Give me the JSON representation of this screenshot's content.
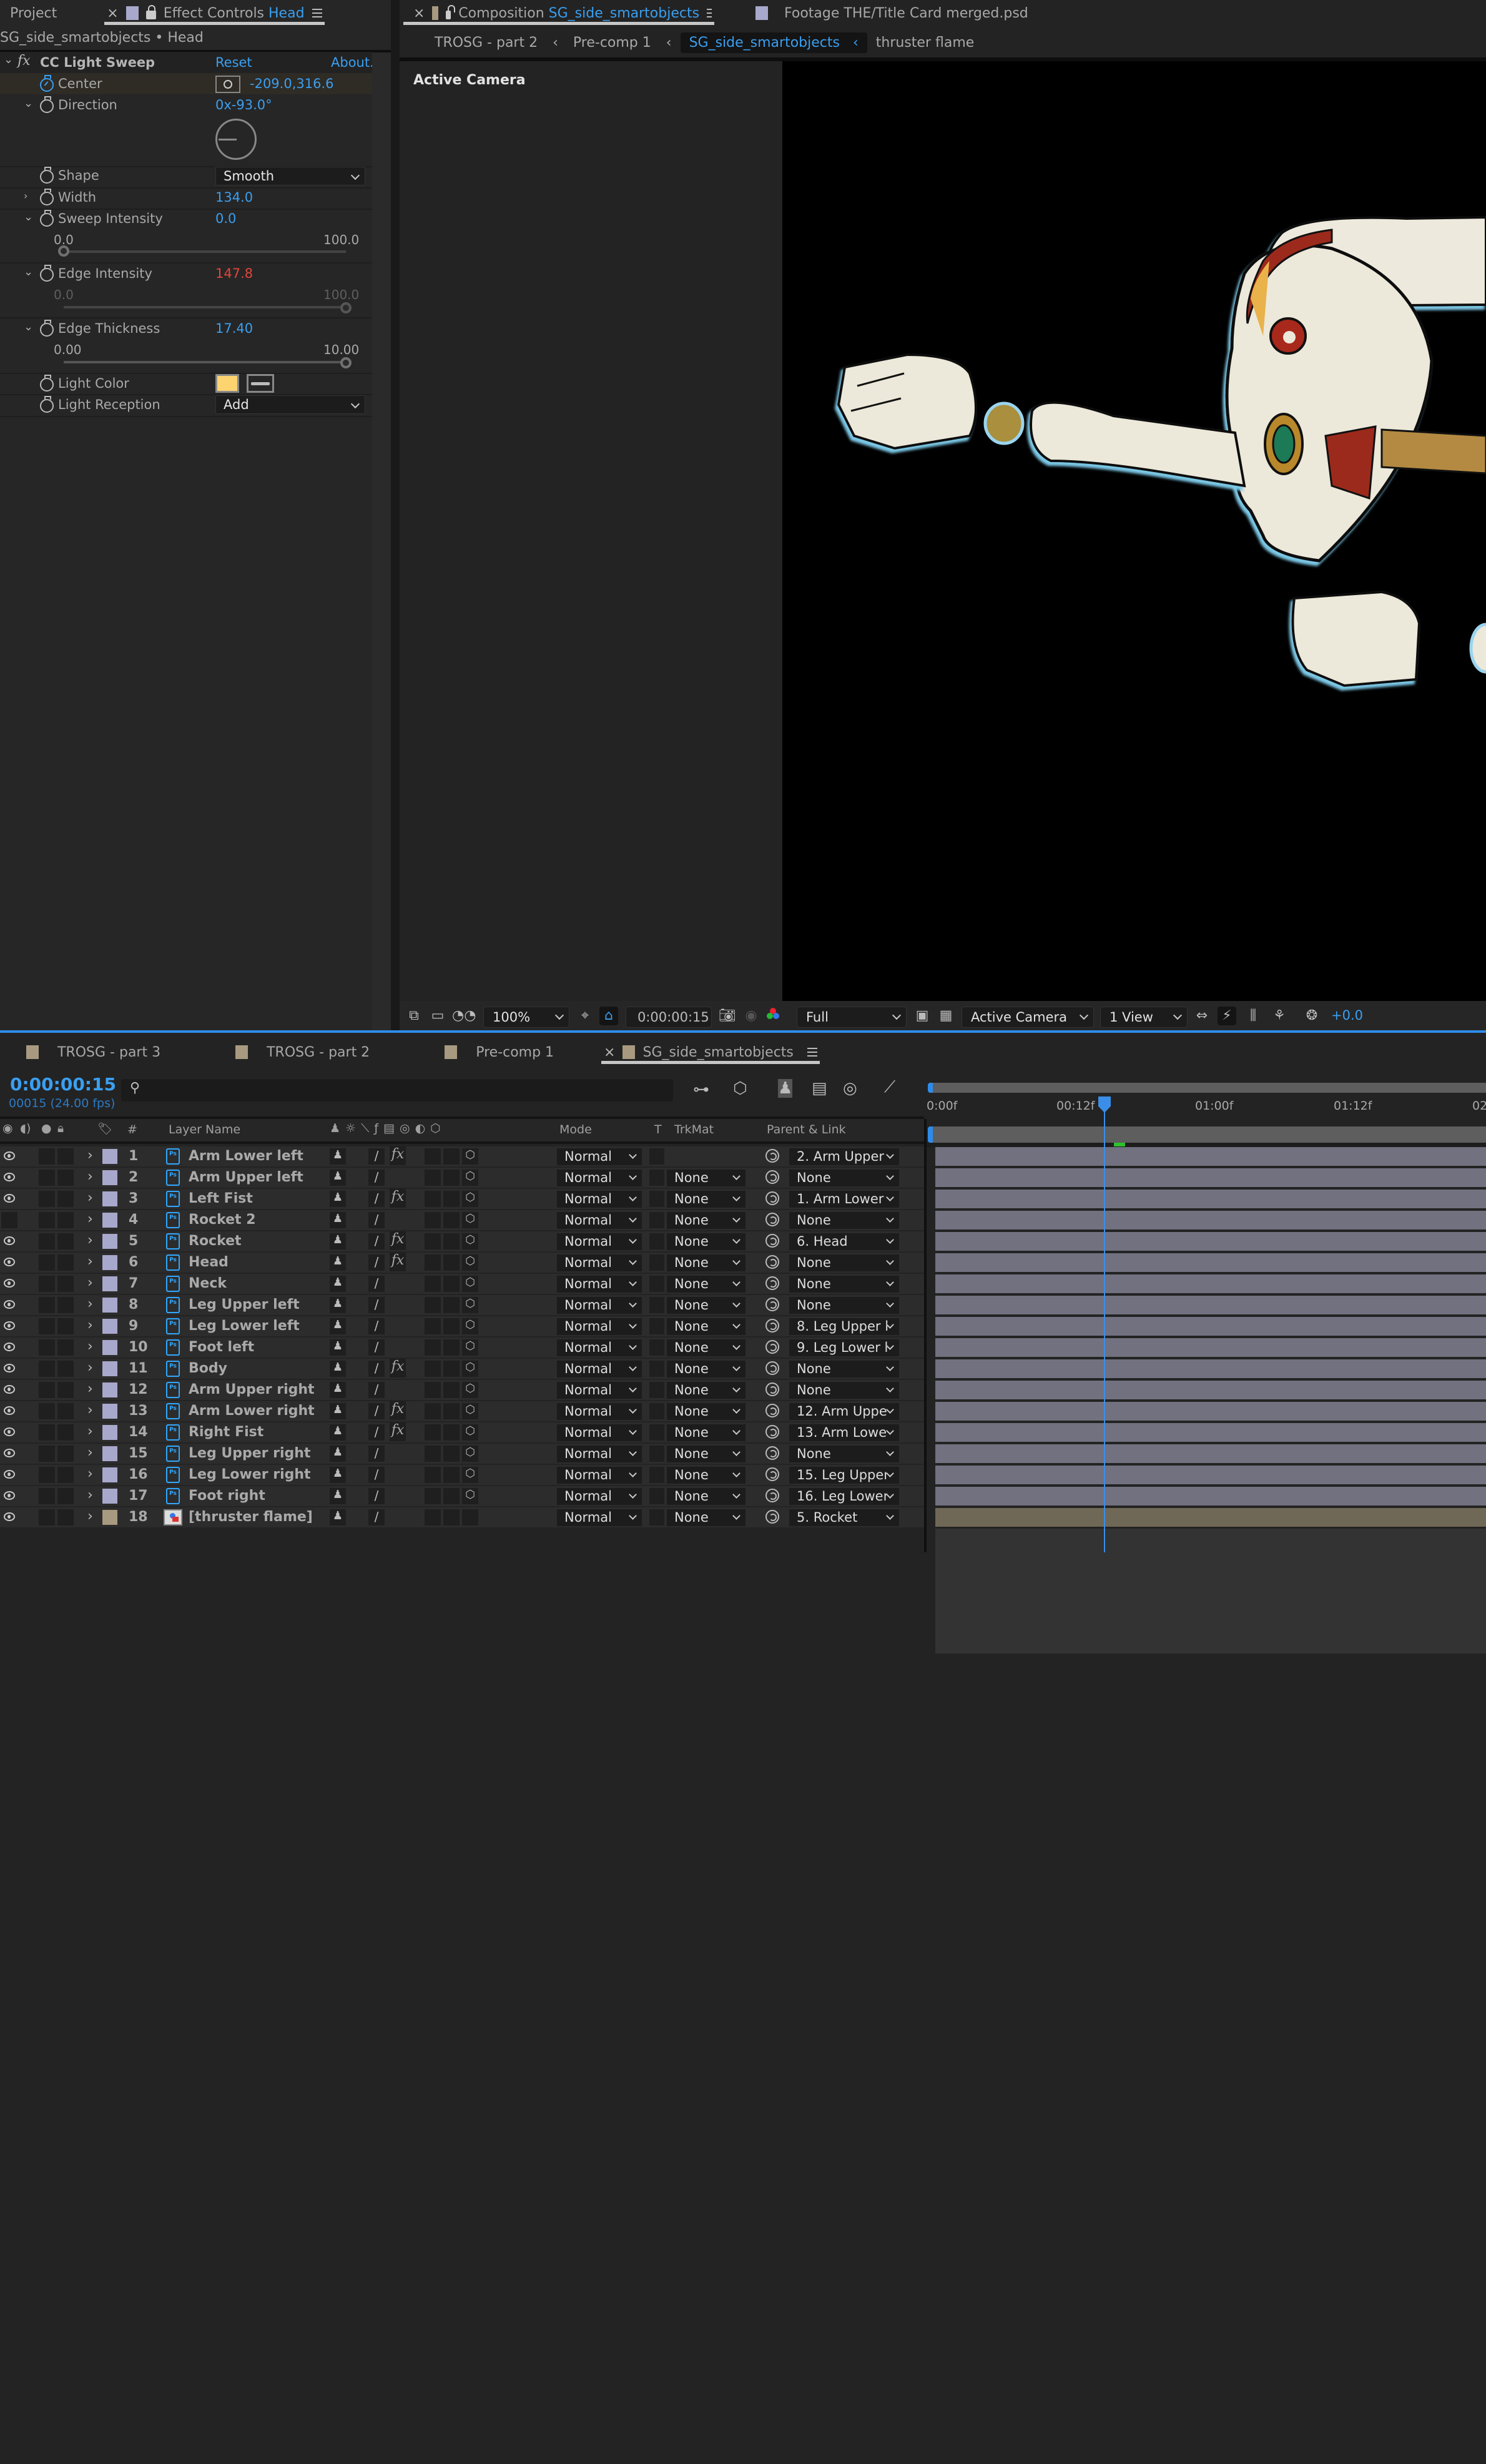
{
  "left_panel": {
    "tabs": [
      {
        "label": "Project"
      },
      {
        "prefix": "Effect Controls",
        "name": "Head",
        "active": true
      }
    ],
    "subtitle": "SG_side_smartobjects • Head",
    "effect": {
      "name": "CC Light Sweep",
      "reset": "Reset",
      "about": "About.",
      "params": {
        "center": {
          "label": "Center",
          "value": "-209.0,316.6"
        },
        "direction": {
          "label": "Direction",
          "value": "0x-93.0°",
          "angle_deg": -93.0
        },
        "shape": {
          "label": "Shape",
          "value": "Smooth"
        },
        "width": {
          "label": "Width",
          "value": "134.0"
        },
        "sweep_intensity": {
          "label": "Sweep Intensity",
          "value": "0.0",
          "min": "0.0",
          "max": "100.0",
          "slider_fraction": 0.0
        },
        "edge_intensity": {
          "label": "Edge Intensity",
          "value": "147.8",
          "min": "0.0",
          "max": "100.0",
          "slider_fraction": 1.0
        },
        "edge_thickness": {
          "label": "Edge Thickness",
          "value": "17.40",
          "min": "0.00",
          "max": "10.00",
          "slider_fraction": 1.0
        },
        "light_color": {
          "label": "Light Color",
          "color": "#fdd46f"
        },
        "light_reception": {
          "label": "Light Reception",
          "value": "Add"
        }
      }
    }
  },
  "comp_panel": {
    "tabs": [
      {
        "prefix": "Composition",
        "name": "SG_side_smartobjects",
        "active": true,
        "color": "#a89a80"
      },
      {
        "label": "Footage THE/Title Card merged.psd",
        "color": "#a8a8cc"
      }
    ],
    "breadcrumbs": [
      "TROSG - part 2",
      "Pre-comp 1",
      "SG_side_smartobjects",
      "thruster flame"
    ],
    "active_breadcrumb": 2,
    "camera_label": "Active Camera",
    "toolbar": {
      "zoom": "100%",
      "timecode": "0:00:00:15",
      "resolution": "Full",
      "camera": "Active Camera",
      "views": "1 View",
      "exposure": "+0.0"
    }
  },
  "timeline": {
    "tabs": [
      {
        "label": "TROSG - part 3"
      },
      {
        "label": "TROSG - part 2"
      },
      {
        "label": "Pre-comp 1"
      },
      {
        "label": "SG_side_smartobjects",
        "active": true
      }
    ],
    "current_time": "0:00:00:15",
    "frame_info": "00015 (24.00 fps)",
    "search_placeholder": "",
    "columns": {
      "num": "#",
      "layer_name": "Layer Name",
      "mode": "Mode",
      "t": "T",
      "trkmat": "TrkMat",
      "parent": "Parent & Link"
    },
    "ruler": [
      "0:00f",
      "00:12f",
      "01:00f",
      "01:12f",
      "02"
    ],
    "playhead_frame": 15,
    "layers": [
      {
        "num": "1",
        "name": "Arm Lower left",
        "visible": true,
        "fx": true,
        "mode": "Normal",
        "trkmat": "",
        "parent": "2. Arm Upper",
        "color": "#a8a8cc"
      },
      {
        "num": "2",
        "name": "Arm Upper left",
        "visible": true,
        "fx": false,
        "mode": "Normal",
        "trkmat": "None",
        "parent": "None",
        "color": "#a8a8cc"
      },
      {
        "num": "3",
        "name": "Left Fist",
        "visible": true,
        "fx": true,
        "mode": "Normal",
        "trkmat": "None",
        "parent": "1. Arm Lower",
        "color": "#a8a8cc"
      },
      {
        "num": "4",
        "name": "Rocket 2",
        "visible": false,
        "fx": false,
        "mode": "Normal",
        "trkmat": "None",
        "parent": "None",
        "color": "#a8a8cc"
      },
      {
        "num": "5",
        "name": "Rocket",
        "visible": true,
        "fx": true,
        "mode": "Normal",
        "trkmat": "None",
        "parent": "6. Head",
        "color": "#a8a8cc"
      },
      {
        "num": "6",
        "name": "Head",
        "visible": true,
        "fx": true,
        "mode": "Normal",
        "trkmat": "None",
        "parent": "None",
        "color": "#a8a8cc"
      },
      {
        "num": "7",
        "name": "Neck",
        "visible": true,
        "fx": false,
        "mode": "Normal",
        "trkmat": "None",
        "parent": "None",
        "color": "#a8a8cc"
      },
      {
        "num": "8",
        "name": "Leg Upper left",
        "visible": true,
        "fx": false,
        "mode": "Normal",
        "trkmat": "None",
        "parent": "None",
        "color": "#a8a8cc"
      },
      {
        "num": "9",
        "name": "Leg Lower left",
        "visible": true,
        "fx": false,
        "mode": "Normal",
        "trkmat": "None",
        "parent": "8. Leg Upper l",
        "color": "#a8a8cc"
      },
      {
        "num": "10",
        "name": "Foot left",
        "visible": true,
        "fx": false,
        "mode": "Normal",
        "trkmat": "None",
        "parent": "9. Leg Lower l",
        "color": "#a8a8cc"
      },
      {
        "num": "11",
        "name": "Body",
        "visible": true,
        "fx": true,
        "mode": "Normal",
        "trkmat": "None",
        "parent": "None",
        "color": "#a8a8cc"
      },
      {
        "num": "12",
        "name": "Arm Upper right",
        "visible": true,
        "fx": false,
        "mode": "Normal",
        "trkmat": "None",
        "parent": "None",
        "color": "#a8a8cc"
      },
      {
        "num": "13",
        "name": "Arm Lower right",
        "visible": true,
        "fx": true,
        "mode": "Normal",
        "trkmat": "None",
        "parent": "12. Arm Uppe",
        "color": "#a8a8cc"
      },
      {
        "num": "14",
        "name": "Right Fist",
        "visible": true,
        "fx": true,
        "mode": "Normal",
        "trkmat": "None",
        "parent": "13. Arm Lowe",
        "color": "#a8a8cc"
      },
      {
        "num": "15",
        "name": "Leg Upper right",
        "visible": true,
        "fx": false,
        "mode": "Normal",
        "trkmat": "None",
        "parent": "None",
        "color": "#a8a8cc"
      },
      {
        "num": "16",
        "name": "Leg Lower right",
        "visible": true,
        "fx": false,
        "mode": "Normal",
        "trkmat": "None",
        "parent": "15. Leg Upper",
        "color": "#a8a8cc"
      },
      {
        "num": "17",
        "name": "Foot right",
        "visible": true,
        "fx": false,
        "mode": "Normal",
        "trkmat": "None",
        "parent": "16. Leg Lower",
        "color": "#a8a8cc"
      },
      {
        "num": "18",
        "name": "[thruster flame]",
        "visible": true,
        "fx": false,
        "mode": "Normal",
        "trkmat": "None",
        "parent": "5. Rocket",
        "color": "#a89a80",
        "precomp": true
      }
    ]
  }
}
